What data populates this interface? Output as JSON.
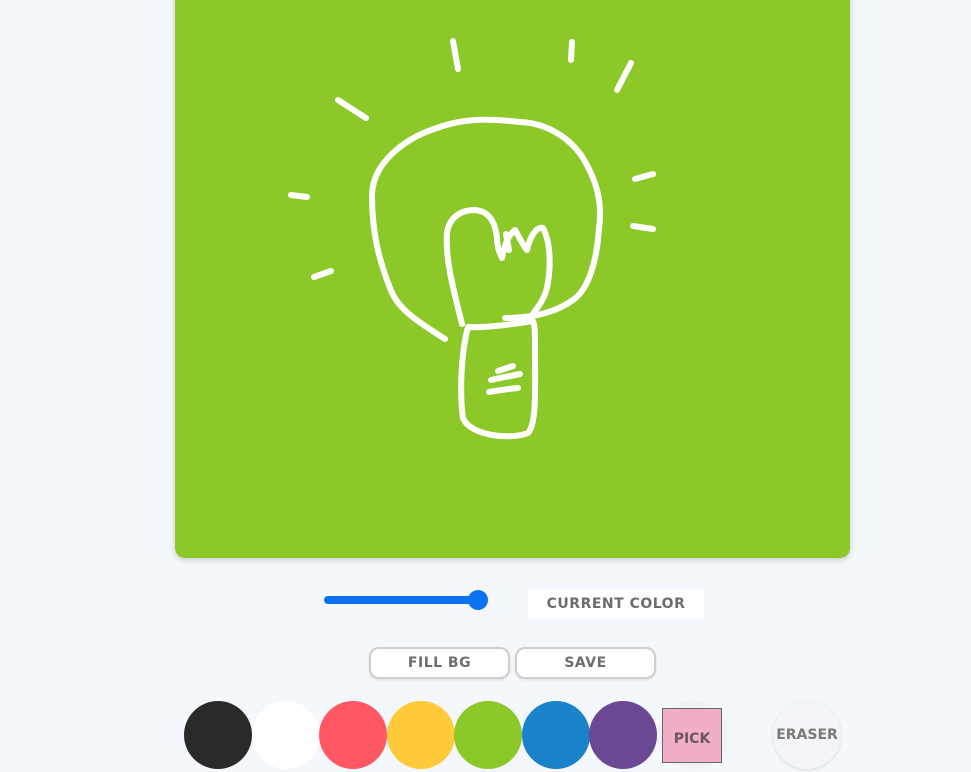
{
  "canvas": {
    "background_color": "#8cc928",
    "stroke_color": "#ffffff",
    "content": "lightbulb-sketch"
  },
  "brush_size_slider": {
    "value_fraction": 0.93,
    "color": "#0d72f0"
  },
  "current_color": {
    "label": "CURRENT COLOR"
  },
  "buttons": {
    "fill_bg": "FILL BG",
    "save": "SAVE",
    "pick": "PICK",
    "eraser": "ERASER"
  },
  "palette": {
    "colors": [
      "#2a2a2a",
      "#ffffff",
      "#ff5864",
      "#ffc93a",
      "#8cc928",
      "#1a82c8",
      "#6b4893"
    ],
    "pick_color": "#f0aec8"
  }
}
